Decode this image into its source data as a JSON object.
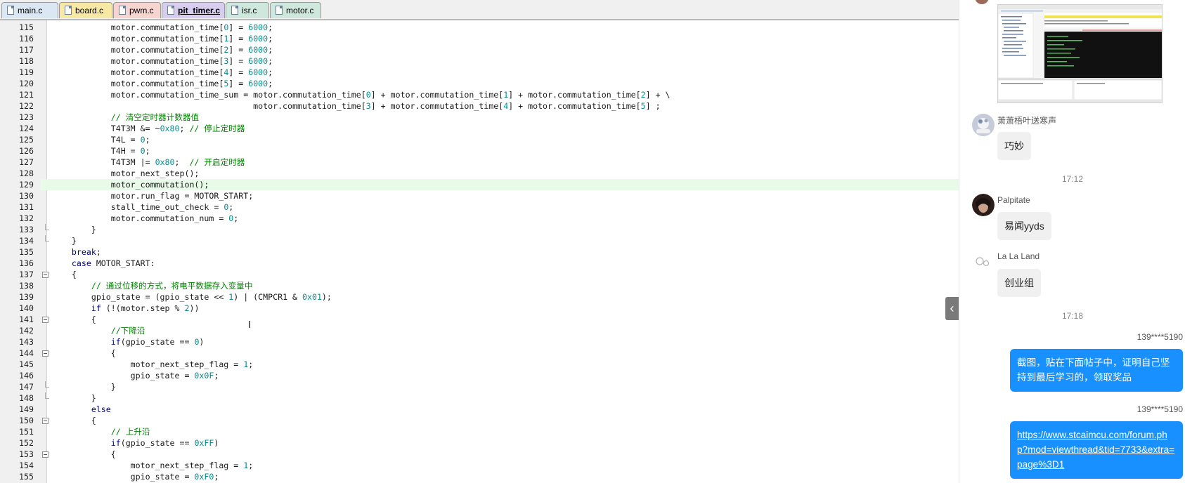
{
  "tabs": [
    {
      "label": "main.c",
      "color": "#dbe8f4"
    },
    {
      "label": "board.c",
      "color": "#f7e9a4"
    },
    {
      "label": "pwm.c",
      "color": "#f6d4d0"
    },
    {
      "label": "pit_timer.c",
      "color": "#d8cdef",
      "active": true
    },
    {
      "label": "isr.c",
      "color": "#cfe8dd"
    },
    {
      "label": "motor.c",
      "color": "#cfe8dd"
    }
  ],
  "code_lines": [
    {
      "n": "115",
      "text": "            motor.commutation_time[0] = 6000;"
    },
    {
      "n": "116",
      "text": "            motor.commutation_time[1] = 6000;"
    },
    {
      "n": "117",
      "text": "            motor.commutation_time[2] = 6000;"
    },
    {
      "n": "118",
      "text": "            motor.commutation_time[3] = 6000;"
    },
    {
      "n": "119",
      "text": "            motor.commutation_time[4] = 6000;"
    },
    {
      "n": "120",
      "text": "            motor.commutation_time[5] = 6000;"
    },
    {
      "n": "121",
      "text": "            motor.commutation_time_sum = motor.commutation_time[0] + motor.commutation_time[1] + motor.commutation_time[2] + \\"
    },
    {
      "n": "122",
      "text": "                                         motor.commutation_time[3] + motor.commutation_time[4] + motor.commutation_time[5] ;"
    },
    {
      "n": "123",
      "text": "            // 清空定时器计数器值"
    },
    {
      "n": "124",
      "text": "            T4T3M &= ~0x80; // 停止定时器"
    },
    {
      "n": "125",
      "text": "            T4L = 0;"
    },
    {
      "n": "126",
      "text": "            T4H = 0;"
    },
    {
      "n": "127",
      "text": "            T4T3M |= 0x80;  // 开启定时器"
    },
    {
      "n": "128",
      "text": "            motor_next_step();"
    },
    {
      "n": "129",
      "text": "            motor_commutation();",
      "hl": true
    },
    {
      "n": "130",
      "text": "            motor.run_flag = MOTOR_START;"
    },
    {
      "n": "131",
      "text": "            stall_time_out_check = 0;"
    },
    {
      "n": "132",
      "text": "            motor.commutation_num = 0;"
    },
    {
      "n": "133",
      "text": "        }",
      "fold": "end"
    },
    {
      "n": "134",
      "text": "    }",
      "fold": "end"
    },
    {
      "n": "135",
      "text": "    break;"
    },
    {
      "n": "136",
      "text": "    case MOTOR_START:"
    },
    {
      "n": "137",
      "text": "    {",
      "fold": "open"
    },
    {
      "n": "138",
      "text": "        // 通过位移的方式，将电平数据存入变量中"
    },
    {
      "n": "139",
      "text": "        gpio_state = (gpio_state << 1) | (CMPCR1 & 0x01);"
    },
    {
      "n": "140",
      "text": "        if (!(motor.step % 2))"
    },
    {
      "n": "141",
      "text": "        {",
      "fold": "open"
    },
    {
      "n": "142",
      "text": "            //下降沿"
    },
    {
      "n": "143",
      "text": "            if(gpio_state == 0)"
    },
    {
      "n": "144",
      "text": "            {",
      "fold": "open"
    },
    {
      "n": "145",
      "text": "                motor_next_step_flag = 1;"
    },
    {
      "n": "146",
      "text": "                gpio_state = 0x0F;"
    },
    {
      "n": "147",
      "text": "            }",
      "fold": "end"
    },
    {
      "n": "148",
      "text": "        }",
      "fold": "end"
    },
    {
      "n": "149",
      "text": "        else"
    },
    {
      "n": "150",
      "text": "        {",
      "fold": "open"
    },
    {
      "n": "151",
      "text": "            // 上升沿"
    },
    {
      "n": "152",
      "text": "            if(gpio_state == 0xFF)"
    },
    {
      "n": "153",
      "text": "            {",
      "fold": "open"
    },
    {
      "n": "154",
      "text": "                motor_next_step_flag = 1;"
    },
    {
      "n": "155",
      "text": "                gpio_state = 0xF0;"
    }
  ],
  "collapse_glyph": "‹",
  "chat": {
    "messages": [
      {
        "user": "萧萧梧叶送寒声",
        "text": "巧妙"
      },
      {
        "time": "17:12"
      },
      {
        "user": "Palpitate",
        "text": "易闻yyds"
      },
      {
        "user": "La La Land",
        "text": "创业组"
      },
      {
        "time": "17:18"
      }
    ],
    "outgoing": [
      {
        "sender": "139****5190",
        "text": "截图，贴在下面帖子中，证明自己坚持到最后学习的，领取奖品"
      },
      {
        "sender": "139****5190",
        "link": "https://www.stcaimcu.com/forum.php?mod=viewthread&tid=7733&extra=page%3D1"
      }
    ]
  },
  "colors": {
    "comment": "#008000",
    "keyword": "#00008b",
    "number": "#098a8a",
    "highlight": "#e8fbe8",
    "bubble_me": "#1890ff"
  }
}
